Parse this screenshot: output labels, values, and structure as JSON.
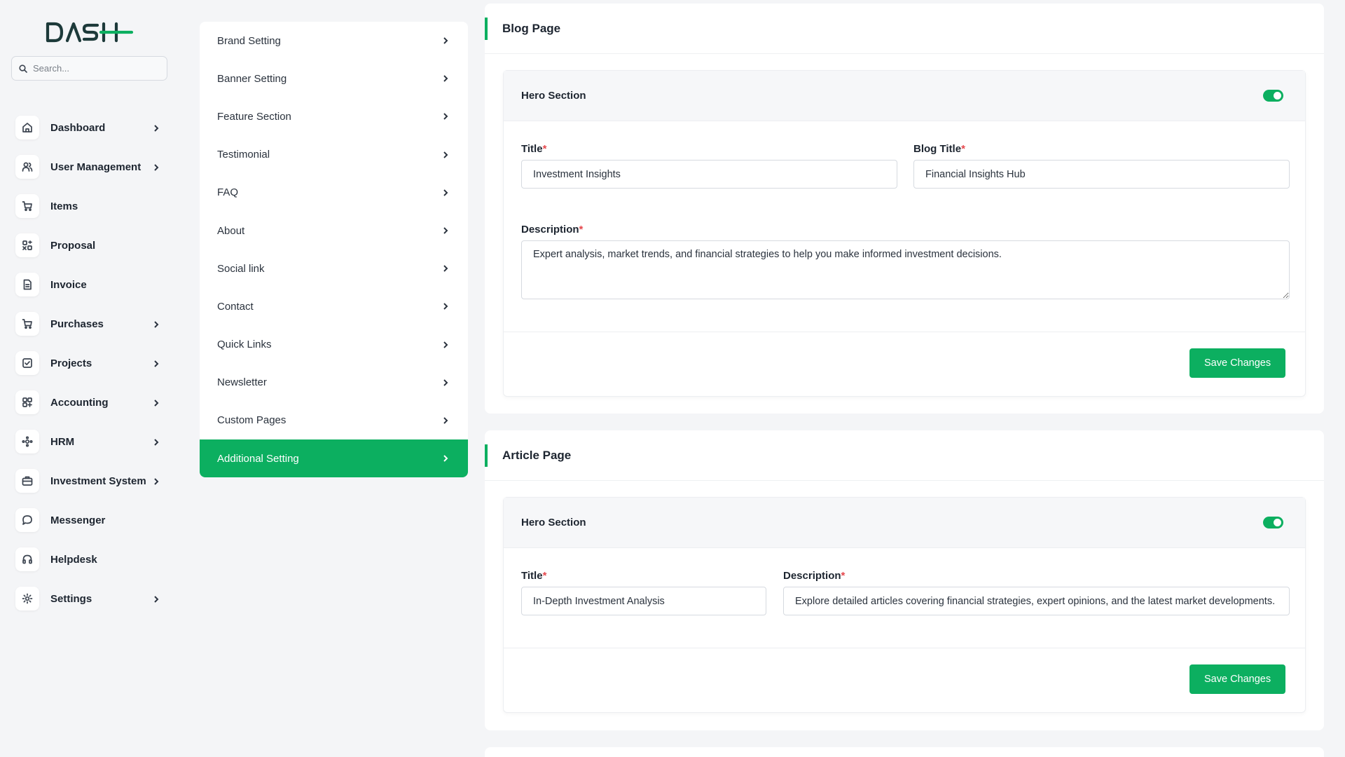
{
  "brand": {
    "logo_text": "DASH",
    "accent": "#0caf60"
  },
  "search": {
    "placeholder": "Search..."
  },
  "sidebar": {
    "items": [
      {
        "label": "Dashboard",
        "icon": "home-icon",
        "has_children": true
      },
      {
        "label": "User Management",
        "icon": "users-icon",
        "has_children": true
      },
      {
        "label": "Items",
        "icon": "cart-icon",
        "has_children": false
      },
      {
        "label": "Proposal",
        "icon": "proposal-icon",
        "has_children": false
      },
      {
        "label": "Invoice",
        "icon": "invoice-icon",
        "has_children": false
      },
      {
        "label": "Purchases",
        "icon": "cart-icon",
        "has_children": true
      },
      {
        "label": "Projects",
        "icon": "check-square-icon",
        "has_children": true
      },
      {
        "label": "Accounting",
        "icon": "grid-icon",
        "has_children": true
      },
      {
        "label": "HRM",
        "icon": "hrm-icon",
        "has_children": true
      },
      {
        "label": "Investment System",
        "icon": "briefcase-icon",
        "has_children": true
      },
      {
        "label": "Messenger",
        "icon": "message-icon",
        "has_children": false
      },
      {
        "label": "Helpdesk",
        "icon": "headphones-icon",
        "has_children": false
      },
      {
        "label": "Settings",
        "icon": "gear-icon",
        "has_children": true
      }
    ]
  },
  "settings_menu": {
    "items": [
      {
        "label": "Brand Setting",
        "active": false
      },
      {
        "label": "Banner Setting",
        "active": false
      },
      {
        "label": "Feature Section",
        "active": false
      },
      {
        "label": "Testimonial",
        "active": false
      },
      {
        "label": "FAQ",
        "active": false
      },
      {
        "label": "About",
        "active": false
      },
      {
        "label": "Social link",
        "active": false
      },
      {
        "label": "Contact",
        "active": false
      },
      {
        "label": "Quick Links",
        "active": false
      },
      {
        "label": "Newsletter",
        "active": false
      },
      {
        "label": "Custom Pages",
        "active": false
      },
      {
        "label": "Additional Setting",
        "active": true
      }
    ]
  },
  "blog_page": {
    "title": "Blog Page",
    "hero": {
      "title": "Hero Section",
      "enabled": true,
      "title_label": "Title",
      "title_value": "Investment Insights",
      "blog_title_label": "Blog Title",
      "blog_title_value": "Financial Insights Hub",
      "description_label": "Description",
      "description_value": "Expert analysis, market trends, and financial strategies to help you make informed investment decisions.",
      "save_label": "Save Changes"
    }
  },
  "article_page": {
    "title": "Article Page",
    "hero": {
      "title": "Hero Section",
      "enabled": true,
      "title_label": "Title",
      "title_value": "In-Depth Investment Analysis",
      "description_label": "Description",
      "description_value": "Explore detailed articles covering financial strategies, expert opinions, and the latest market developments.",
      "save_label": "Save Changes"
    }
  },
  "required_marker": "*"
}
